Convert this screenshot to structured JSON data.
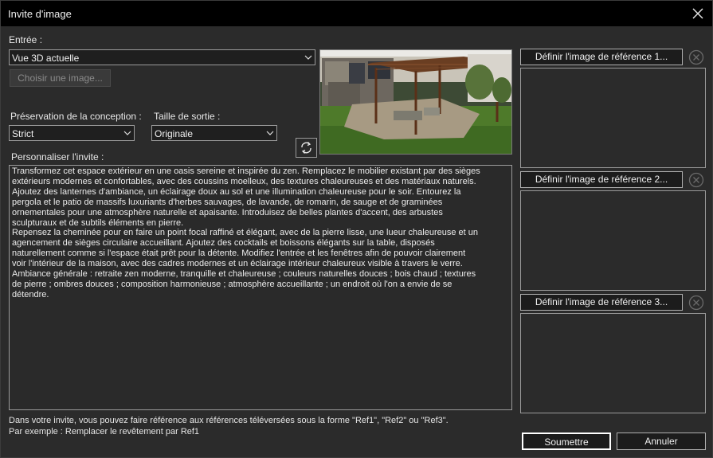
{
  "window": {
    "title": "Invite d'image",
    "close_icon": "close-icon"
  },
  "input": {
    "label": "Entrée :",
    "source_value": "Vue 3D actuelle",
    "choose_image_label": "Choisir une image..."
  },
  "design": {
    "label": "Préservation de la conception :",
    "value": "Strict"
  },
  "output": {
    "label": "Taille de sortie :",
    "value": "Originale"
  },
  "prompt": {
    "label": "Personnaliser l'invite :",
    "lines": [
      "Transformez cet espace extérieur en une oasis sereine et inspirée du zen. Remplacez le mobilier existant par des sièges",
      "extérieurs modernes et confortables, avec des coussins moelleux, des textures chaleureuses et des matériaux naturels.",
      "Ajoutez des lanternes d'ambiance, un éclairage doux au sol et une illumination chaleureuse pour le soir. Entourez la",
      "pergola et le patio de massifs luxuriants d'herbes sauvages, de lavande, de romarin, de sauge et de graminées",
      "ornementales pour une atmosphère naturelle et apaisante. Introduisez de belles plantes d'accent, des arbustes",
      "sculpturaux et de subtils éléments en pierre.",
      "Repensez la cheminée pour en faire un point focal raffiné et élégant, avec de la pierre lisse, une lueur chaleureuse et un",
      "agencement de sièges circulaire accueillant. Ajoutez des cocktails et boissons élégants sur la table, disposés",
      "naturellement comme si l'espace était prêt pour la détente. Modifiez l'entrée et les fenêtres afin de pouvoir clairement",
      "voir l'intérieur de la maison, avec des cadres modernes et un éclairage intérieur chaleureux visible à travers le verre.",
      "Ambiance générale : retraite zen moderne, tranquille et chaleureuse ; couleurs naturelles douces ; bois chaud ; textures",
      "de pierre ; ombres douces ; composition harmonieuse ; atmosphère accueillante ; un endroit où l'on a envie de se",
      "détendre."
    ]
  },
  "references": {
    "ref1_label": "Définir l'image de référence 1...",
    "ref2_label": "Définir l'image de référence 2...",
    "ref3_label": "Définir l'image de référence 3..."
  },
  "hint": {
    "line1": "Dans votre invite, vous pouvez faire référence aux références téléversées sous la forme \"Ref1\", \"Ref2\" ou \"Ref3\".",
    "line2": "Par exemple : Remplacer le revêtement par Ref1"
  },
  "actions": {
    "submit_label": "Soumettre",
    "cancel_label": "Annuler"
  },
  "colors": {
    "background": "#2b2b2b",
    "titlebar": "#000000",
    "primary_button_border": "#ffffff"
  }
}
